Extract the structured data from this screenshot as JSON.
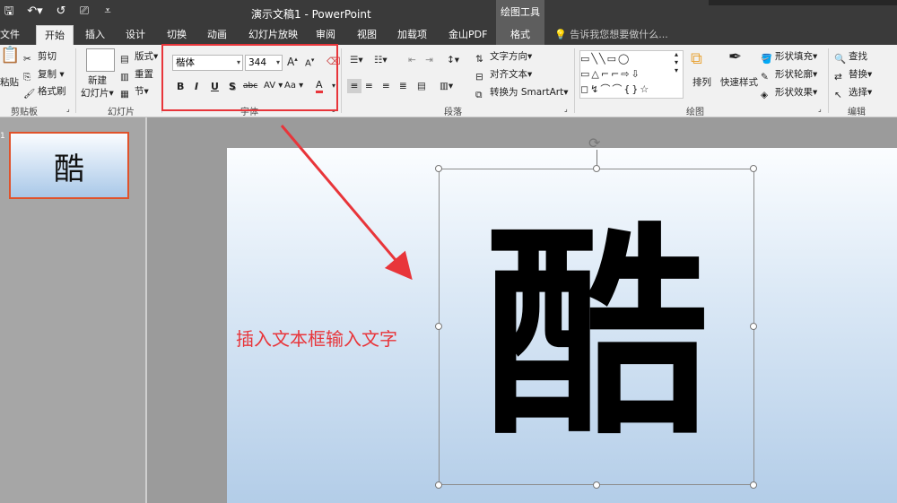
{
  "titlebar": {
    "title": "演示文稿1 - PowerPoint",
    "context_group": "绘图工具",
    "qat": {
      "save": "🖫",
      "undo": "↶▾",
      "redo": "↺",
      "present": "⎚",
      "customize": "⩡"
    }
  },
  "tabs": [
    {
      "label": "文件"
    },
    {
      "label": "开始"
    },
    {
      "label": "插入"
    },
    {
      "label": "设计"
    },
    {
      "label": "切换"
    },
    {
      "label": "动画"
    },
    {
      "label": "幻灯片放映"
    },
    {
      "label": "审阅"
    },
    {
      "label": "视图"
    },
    {
      "label": "加载项"
    },
    {
      "label": "金山PDF"
    },
    {
      "label": "格式"
    }
  ],
  "tell_me": "告诉我您想要做什么...",
  "ribbon": {
    "clipboard": {
      "paste": "粘贴",
      "cut": "剪切",
      "copy": "复制",
      "painter": "格式刷",
      "label": "剪贴板"
    },
    "slides": {
      "new_slide_1": "新建",
      "new_slide_2": "幻灯片",
      "layout": "版式",
      "reset": "重置",
      "section": "节",
      "label": "幻灯片"
    },
    "font": {
      "font_name": "楷体",
      "font_size": "344",
      "grow": "A",
      "shrink": "A",
      "bold": "B",
      "italic": "I",
      "underline": "U",
      "shadow": "S",
      "strike": "abc",
      "spacing": "AV",
      "case": "Aa",
      "color": "A",
      "label": "字体"
    },
    "paragraph": {
      "text_direction": "文字方向",
      "align_text": "对齐文本",
      "smartart": "转换为 SmartArt",
      "label": "段落"
    },
    "drawing": {
      "arrange": "排列",
      "quick_styles": "快速样式",
      "fill": "形状填充",
      "outline": "形状轮廓",
      "effects": "形状效果",
      "label": "绘图"
    },
    "editing": {
      "find": "查找",
      "replace": "替换",
      "select": "选择",
      "label": "编辑"
    }
  },
  "thumbnail": {
    "number": "1",
    "char": "酷"
  },
  "slide": {
    "annotation": "插入文本框输入文字",
    "big_char": "酷"
  },
  "colors": {
    "accent": "#e8353a",
    "titlebar": "#3a3a3a",
    "ribbon": "#f1f1f1"
  }
}
